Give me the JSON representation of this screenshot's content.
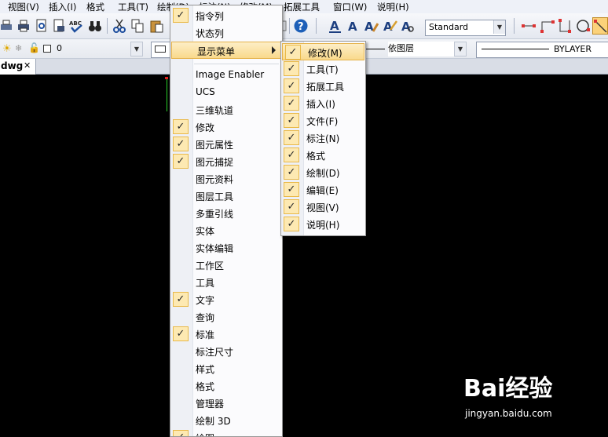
{
  "menubar": {
    "items": [
      "视图(V)",
      "插入(I)",
      "格式",
      "工具(T)",
      "绘制(D)",
      "标注(N)",
      "修改(M)",
      "拓展工具",
      "窗口(W)",
      "说明(H)"
    ]
  },
  "toolbar": {
    "text_style": "Standard"
  },
  "layer_bar": {
    "layer_name": "0",
    "linetype_label": "依图层",
    "lineweight_label": "BYLAYER"
  },
  "document_tab": {
    "name": "dwg",
    "close_glyph": "✕"
  },
  "toolbar_menu": {
    "items": [
      {
        "label": "指令列",
        "checked": true
      },
      {
        "label": "状态列",
        "checked": false
      },
      {
        "label": "显示菜单",
        "checked": false,
        "submenu": true,
        "highlighted": true
      },
      {
        "label": "Image Enabler",
        "checked": false
      },
      {
        "label": "UCS",
        "checked": false
      },
      {
        "label": "三维轨道",
        "checked": false
      },
      {
        "label": "修改",
        "checked": true
      },
      {
        "label": "图元属性",
        "checked": true
      },
      {
        "label": "图元捕捉",
        "checked": true
      },
      {
        "label": "图元资料",
        "checked": false
      },
      {
        "label": "图层工具",
        "checked": false
      },
      {
        "label": "多重引线",
        "checked": false
      },
      {
        "label": "实体",
        "checked": false
      },
      {
        "label": "实体编辑",
        "checked": false
      },
      {
        "label": "工作区",
        "checked": false
      },
      {
        "label": "工具",
        "checked": false
      },
      {
        "label": "文字",
        "checked": true
      },
      {
        "label": "查询",
        "checked": false
      },
      {
        "label": "标准",
        "checked": true
      },
      {
        "label": "标注尺寸",
        "checked": false
      },
      {
        "label": "样式",
        "checked": false
      },
      {
        "label": "格式",
        "checked": false
      },
      {
        "label": "管理器",
        "checked": false
      },
      {
        "label": "绘制 3D",
        "checked": false
      },
      {
        "label": "绘图",
        "checked": true
      }
    ]
  },
  "display_menu_submenu": {
    "items": [
      {
        "label": "修改(M)",
        "checked": true,
        "highlighted": true
      },
      {
        "label": "工具(T)",
        "checked": true
      },
      {
        "label": "拓展工具",
        "checked": true
      },
      {
        "label": "插入(I)",
        "checked": true
      },
      {
        "label": "文件(F)",
        "checked": true
      },
      {
        "label": "标注(N)",
        "checked": true
      },
      {
        "label": "格式",
        "checked": true
      },
      {
        "label": "绘制(D)",
        "checked": true
      },
      {
        "label": "编辑(E)",
        "checked": true
      },
      {
        "label": "视图(V)",
        "checked": true
      },
      {
        "label": "说明(H)",
        "checked": true
      }
    ]
  },
  "check_glyph": "✓",
  "watermark": {
    "logo": "Bai经验",
    "url": "jingyan.baidu.com"
  }
}
